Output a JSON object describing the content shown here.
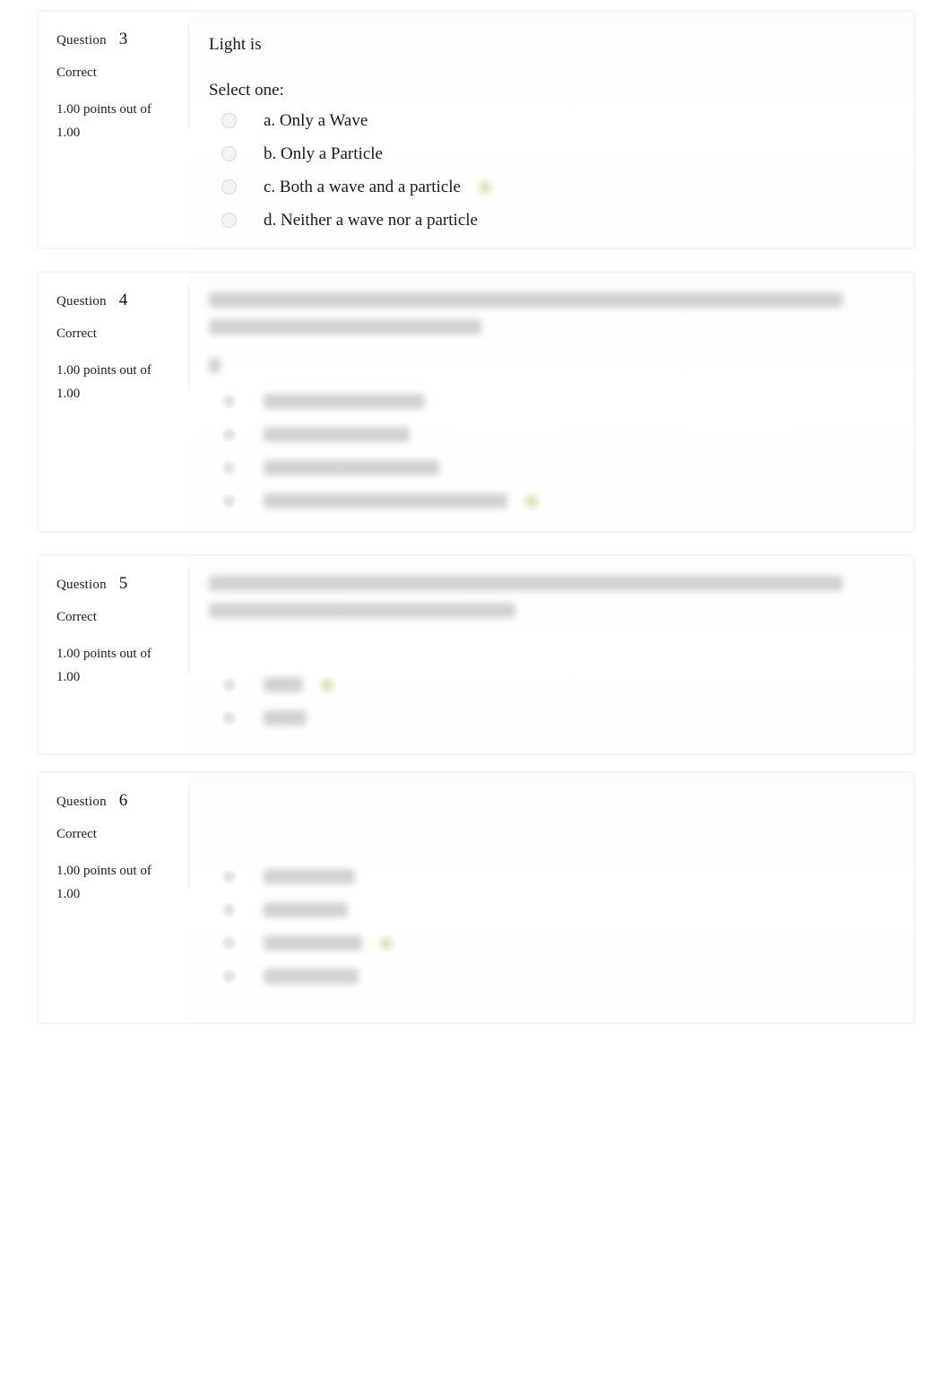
{
  "page": {
    "background": "#ffffff",
    "card_border_color": "#eef4f6",
    "divider_color": "#ececec",
    "correct_marker_color": "#bec878"
  },
  "questions": [
    {
      "id": "q3",
      "number_label": "Question",
      "number": "3",
      "state": "Correct",
      "mark": "1.00 points out of 1.00",
      "text": "Light is",
      "select_label": "Select one:",
      "redacted": false,
      "answers": [
        {
          "letter": "a.",
          "text": "Only a Wave",
          "label": "a. Only a Wave",
          "correct": false
        },
        {
          "letter": "b.",
          "text": "Only a Particle",
          "label": "b. Only a Particle",
          "correct": false
        },
        {
          "letter": "c.",
          "text": "Both a wave and a particle",
          "label": "c. Both a wave and a particle",
          "correct": true
        },
        {
          "letter": "d.",
          "text": "Neither a wave nor a particle",
          "label": "d. Neither a wave nor a particle",
          "correct": false
        }
      ]
    },
    {
      "id": "q4",
      "number_label": "Question",
      "number": "4",
      "state": "Correct",
      "mark": "1.00 points out of 1.00",
      "text": "",
      "select_label": "",
      "redacted": true,
      "answers": [
        {
          "letter": "a.",
          "text": "",
          "label": "",
          "correct": false
        },
        {
          "letter": "b.",
          "text": "",
          "label": "",
          "correct": false
        },
        {
          "letter": "c.",
          "text": "",
          "label": "",
          "correct": false
        },
        {
          "letter": "d.",
          "text": "",
          "label": "",
          "correct": true
        }
      ]
    },
    {
      "id": "q5",
      "number_label": "Question",
      "number": "5",
      "state": "Correct",
      "mark": "1.00 points out of 1.00",
      "text": "",
      "select_label": "",
      "redacted": true,
      "answers": [
        {
          "letter": "",
          "text": "",
          "label": "",
          "correct": true
        },
        {
          "letter": "",
          "text": "",
          "label": "",
          "correct": false
        }
      ]
    },
    {
      "id": "q6",
      "number_label": "Question",
      "number": "6",
      "state": "Correct",
      "mark": "1.00 points out of 1.00",
      "text": "",
      "select_label": "",
      "redacted": true,
      "answers": [
        {
          "letter": "a.",
          "text": "",
          "label": "",
          "correct": false
        },
        {
          "letter": "b.",
          "text": "",
          "label": "",
          "correct": false
        },
        {
          "letter": "c.",
          "text": "",
          "label": "",
          "correct": true
        },
        {
          "letter": "d.",
          "text": "",
          "label": "",
          "correct": false
        }
      ]
    }
  ]
}
